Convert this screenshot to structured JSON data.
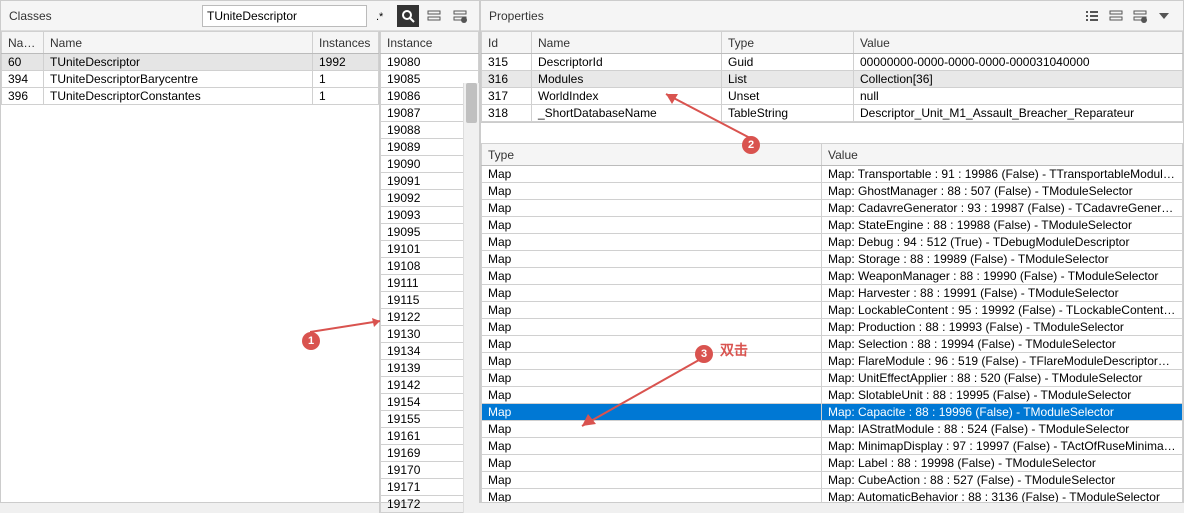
{
  "left": {
    "title": "Classes",
    "filter": "TUniteDescriptor",
    "headers": {
      "id": "Name",
      "name": "Name",
      "count": "Instances",
      "inst": "Instance"
    },
    "classes": [
      {
        "id": "60",
        "name": "TUniteDescriptor",
        "count": "1992",
        "selected": true
      },
      {
        "id": "394",
        "name": "TUniteDescriptorBarycentre",
        "count": "1"
      },
      {
        "id": "396",
        "name": "TUniteDescriptorConstantes",
        "count": "1"
      }
    ],
    "instances": [
      "19080",
      "19085",
      "19086",
      "19087",
      "19088",
      "19089",
      "19090",
      "19091",
      "19092",
      "19093",
      "19095",
      "19101",
      "19108",
      "19111",
      "19115",
      "19122",
      "19130",
      "19134",
      "19139",
      "19142",
      "19154",
      "19155",
      "19161",
      "19169",
      "19170",
      "19171",
      "19172"
    ],
    "selectedInstance": "19130"
  },
  "right": {
    "title": "Properties",
    "headers": {
      "id": "Id",
      "name": "Name",
      "type": "Type",
      "value": "Value"
    },
    "props": [
      {
        "id": "315",
        "name": "DescriptorId",
        "type": "Guid",
        "value": "00000000-0000-0000-0000-000031040000"
      },
      {
        "id": "316",
        "name": "Modules",
        "type": "List",
        "value": "Collection[36]",
        "selected": true
      },
      {
        "id": "317",
        "name": "WorldIndex",
        "type": "Unset",
        "value": "null"
      },
      {
        "id": "318",
        "name": "_ShortDatabaseName",
        "type": "TableString",
        "value": "Descriptor_Unit_M1_Assault_Breacher_Reparateur"
      }
    ],
    "modHeaders": {
      "type": "Type",
      "value": "Value"
    },
    "modules": [
      {
        "type": "Map",
        "value": "Map: Transportable : 91 : 19986 (False) - TTransportableModuleDes"
      },
      {
        "type": "Map",
        "value": "Map: GhostManager : 88 : 507 (False) - TModuleSelector"
      },
      {
        "type": "Map",
        "value": "Map: CadavreGenerator : 93 : 19987 (False) - TCadavreGeneratorMo"
      },
      {
        "type": "Map",
        "value": "Map: StateEngine : 88 : 19988 (False) - TModuleSelector"
      },
      {
        "type": "Map",
        "value": "Map: Debug : 94 : 512 (True) - TDebugModuleDescriptor"
      },
      {
        "type": "Map",
        "value": "Map: Storage : 88 : 19989 (False) - TModuleSelector"
      },
      {
        "type": "Map",
        "value": "Map: WeaponManager : 88 : 19990 (False) - TModuleSelector"
      },
      {
        "type": "Map",
        "value": "Map: Harvester : 88 : 19991 (False) - TModuleSelector"
      },
      {
        "type": "Map",
        "value": "Map: LockableContent : 95 : 19992 (False) - TLockableContentModu"
      },
      {
        "type": "Map",
        "value": "Map: Production : 88 : 19993 (False) - TModuleSelector"
      },
      {
        "type": "Map",
        "value": "Map: Selection : 88 : 19994 (False) - TModuleSelector"
      },
      {
        "type": "Map",
        "value": "Map: FlareModule : 96 : 519 (False) - TFlareModuleDescriptor_MW"
      },
      {
        "type": "Map",
        "value": "Map: UnitEffectApplier : 88 : 520 (False) - TModuleSelector"
      },
      {
        "type": "Map",
        "value": "Map: SlotableUnit : 88 : 19995 (False) - TModuleSelector"
      },
      {
        "type": "Map",
        "value": "Map: Capacite : 88 : 19996 (False) - TModuleSelector",
        "selected": true
      },
      {
        "type": "Map",
        "value": "Map: IAStratModule : 88 : 524 (False) - TModuleSelector"
      },
      {
        "type": "Map",
        "value": "Map: MinimapDisplay : 97 : 19997 (False) - TActOfRuseMinimapDisp"
      },
      {
        "type": "Map",
        "value": "Map: Label : 88 : 19998 (False) - TModuleSelector"
      },
      {
        "type": "Map",
        "value": "Map: CubeAction : 88 : 527 (False) - TModuleSelector"
      },
      {
        "type": "Map",
        "value": "Map: AutomaticBehavior : 88 : 3136 (False) - TModuleSelector"
      }
    ]
  },
  "anno": {
    "b1": "1",
    "b2": "2",
    "b3": "3",
    "dbl": "双击"
  }
}
